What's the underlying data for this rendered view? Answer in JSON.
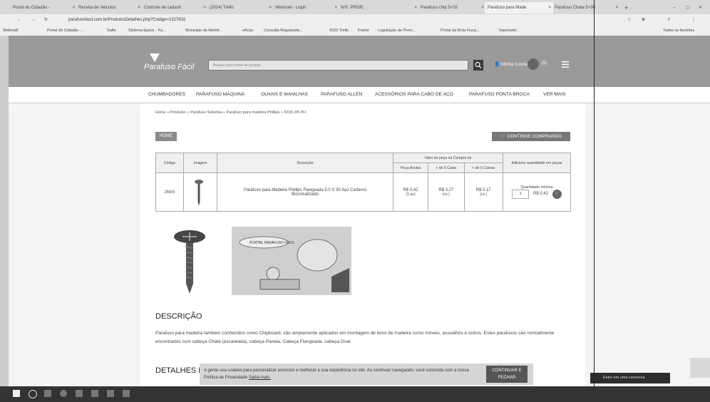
{
  "browser": {
    "tabs": [
      "Portal do Cidadão -",
      "Receita de Veiculos",
      "Controle de cadastr",
      "(2024) Trello",
      "Webmail - Login",
      "N/S: PRO/E",
      "Parafuso chip 5×32",
      "Parafuso para Made",
      "Parafuso Chata 5×30"
    ],
    "url": "parafusofacil.com.br/ProdutosDetalhes.php?Codigo=1327632",
    "bookmarks": [
      "Webmail",
      "Portal do Cidadão -...",
      "Safie",
      "Sistema Epsoc - Fa...",
      "Municipio de Meridi...",
      "eAcss",
      "Consulta Regularida...",
      "2022 Trello",
      "Frame",
      "Legislação de Previ...",
      "Portal da Nota Fisca...",
      "Importado"
    ],
    "bookmarks_right": "Todos os favoritos"
  },
  "site": {
    "logo": "Parafuso Fácil",
    "search_placeholder": "Busque pelo nome do produto",
    "login": "Minha Conta",
    "cart_count": "(0)",
    "nav": [
      "CHUMBADORES",
      "PARAFUSO MÁQUINA",
      "OLHAIS E MANILHAS",
      "PARAFUSO ALLEN",
      "ACESSÓRIOS PARA CABO DE AÇO",
      "PARAFUSO PONTA BROCA",
      "VER MAIS"
    ]
  },
  "breadcrumb": [
    "Home",
    "Produtos",
    "Parafuso Soberba",
    "Parafuso para madeira Phillips",
    "5X30 ZB PH"
  ],
  "buttons": {
    "home": "HOME",
    "continue": "CONTINUE COMPRANDO"
  },
  "table": {
    "col_code": "Código",
    "col_image": "Imagem",
    "col_desc": "Descrição",
    "col_price_group": "Valor de peça na Compra de",
    "col_price_1": "Peça Avulsa",
    "col_price_2": "+ de 5 Caixa",
    "col_price_3": "+ de 5 Caixas",
    "col_add": "Adicione quantidade em peças",
    "row": {
      "code": "25606",
      "description": "Parafuso para Madeira Phillips Flangeada 5.0 X 30 Aço Carbono Bicromatizado",
      "price_1": "R$ 0,42",
      "price_1_sub": "(1 pç)",
      "price_2": "R$ 0,27",
      "price_2_sub": "(cx.)",
      "price_3": "R$ 0,17",
      "price_3_sub": "(cx.)",
      "qty_label": "Quantidade mínima",
      "qty_value": "1",
      "qty_price": "R$ 0,42"
    }
  },
  "cartoon_label": "PORTAL PARAFUSO FÁCIL",
  "description": {
    "title": "DESCRIÇÃO",
    "text": "Parafuso para madeira também conhecidos como Chipboard, são amplamente aplicados em montagem de itens de madeira como móveis, assoalhos e outros. Estes parafusos são normalmente encontrados com cabeça Chata (escareada), cabeça Panela, Cabeça Flangeada, cabeça Oval."
  },
  "details_title": "DETALHES DO PRODUTO",
  "cookie": {
    "text": "A gente usa cookies para personalizar anúncios e melhorar a sua experiência no site. Ao continuar navegando, você concorda com a nossa Política de Privacidade",
    "link": "Saiba mais.",
    "button": "CONTINUAR E FECHAR"
  },
  "chat": "Entre em uma conversa"
}
